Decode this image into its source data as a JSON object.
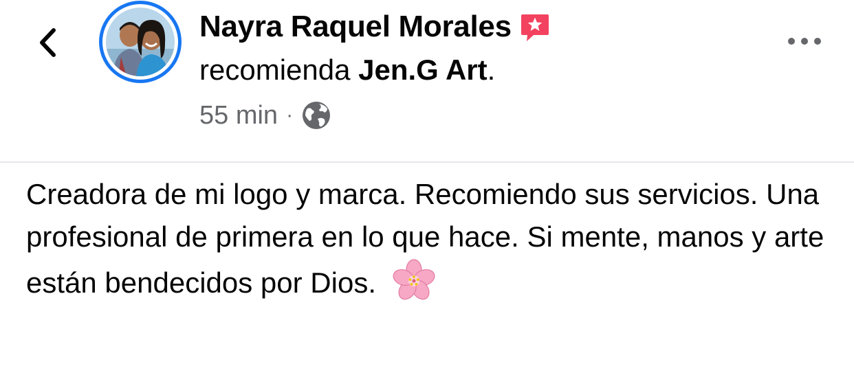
{
  "header": {
    "author_name": "Nayra Raquel Morales",
    "recommend_verb": "recomienda",
    "recommended_page": "Jen.G Art",
    "recommend_end": ".",
    "timestamp": "55 min",
    "separator": "·",
    "privacy_icon": "globe-icon",
    "back_icon": "chevron-left-icon",
    "more_icon": "more-horizontal-icon",
    "badge_icon": "recommendation-star-badge-icon"
  },
  "post": {
    "text": "Creadora de mi logo y marca. Recomiendo sus servicios. Una profesional de primera en lo que hace. Si mente, manos y arte están bendecidos por Dios.",
    "emoji": "cherry-blossom-icon"
  },
  "colors": {
    "accent_blue": "#1877f2",
    "badge_pink": "#f3425f",
    "meta_gray": "#65676b",
    "text": "#050505"
  }
}
